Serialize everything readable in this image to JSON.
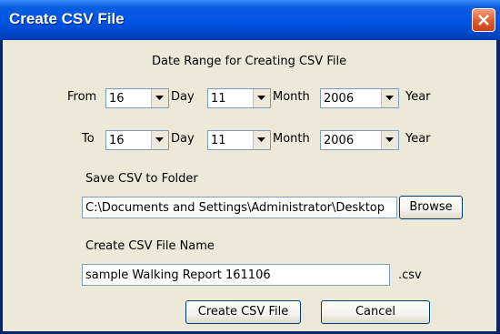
{
  "window": {
    "title": "Create CSV File"
  },
  "date_range": {
    "heading": "Date Range for Creating CSV File",
    "from": {
      "label": "From",
      "day": "16",
      "day_unit": "Day",
      "month": "11",
      "month_unit": "Month",
      "year": "2006",
      "year_unit": "Year"
    },
    "to": {
      "label": "To",
      "day": "16",
      "day_unit": "Day",
      "month": "11",
      "month_unit": "Month",
      "year": "2006",
      "year_unit": "Year"
    }
  },
  "folder": {
    "label": "Save CSV to Folder",
    "value": "C:\\Documents and Settings\\Administrator\\Desktop",
    "browse_label": "Browse"
  },
  "filename": {
    "label": "Create CSV File Name",
    "value": "sample Walking Report 161106",
    "extension": ".csv"
  },
  "actions": {
    "create_label": "Create CSV File",
    "cancel_label": "Cancel"
  },
  "colors": {
    "titlebar": "#0054e3",
    "dialog_bg": "#ece9d8",
    "close": "#e05a30",
    "field_border": "#7f9db9"
  }
}
